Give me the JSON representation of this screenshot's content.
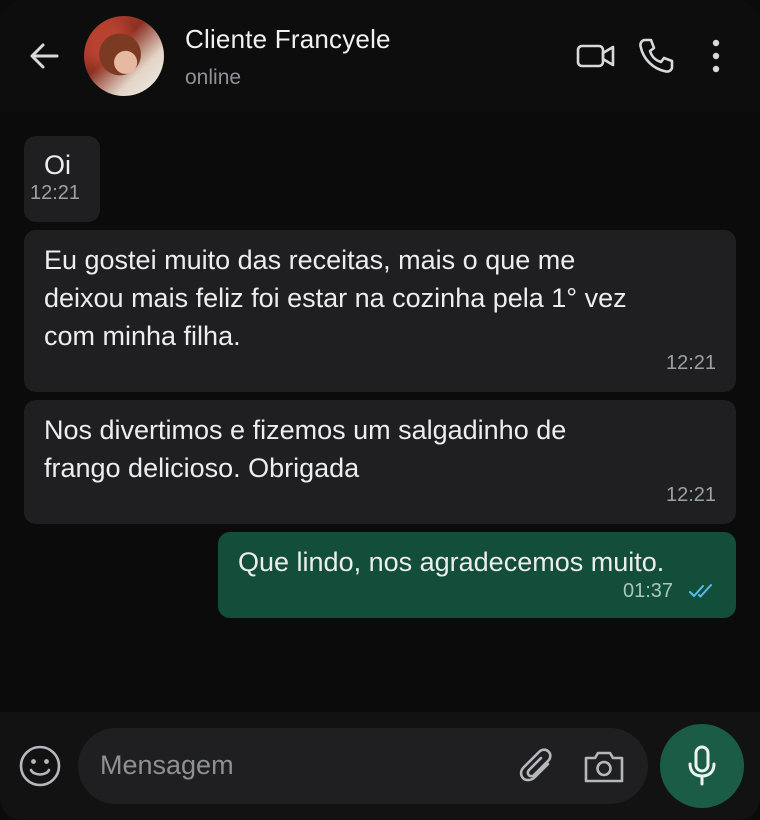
{
  "header": {
    "back_icon": "arrow-left-icon",
    "contact_name": "Cliente Francyele",
    "contact_status": "online",
    "actions": [
      "video-call-icon",
      "phone-icon",
      "more-vertical-icon"
    ]
  },
  "messages": [
    {
      "direction": "incoming",
      "text": "Oi",
      "time": "12:21"
    },
    {
      "direction": "incoming",
      "lines": [
        "Eu gostei muito das receitas, mais o que me",
        "deixou mais feliz foi estar na cozinha pela 1° vez",
        "com minha filha."
      ],
      "time": "12:21"
    },
    {
      "direction": "incoming",
      "lines": [
        "Nos divertimos e fizemos um salgadinho de",
        "frango delicioso. Obrigada"
      ],
      "time": "12:21"
    },
    {
      "direction": "outgoing",
      "text": "Que lindo, nos agradecemos muito.",
      "time": "01:37",
      "read_receipt": "double-check-icon"
    }
  ],
  "composer": {
    "placeholder": "Mensagem",
    "icons": [
      "emoji-icon",
      "paperclip-icon",
      "camera-icon",
      "microphone-icon"
    ]
  },
  "colors": {
    "background": "#0b0b0c",
    "incoming_bubble": "#1f1f21",
    "outgoing_bubble": "#134e3a",
    "mic_button": "#1a5c45",
    "read_receipt": "#53bdeb"
  }
}
